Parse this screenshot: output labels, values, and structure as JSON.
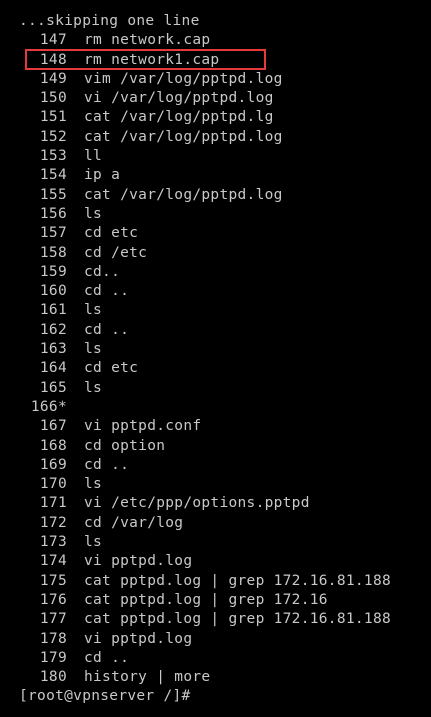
{
  "terminal": {
    "header_line": "...skipping one line",
    "history": [
      {
        "num": "147",
        "cmd": "rm network.cap"
      },
      {
        "num": "148",
        "cmd": "rm network1.cap"
      },
      {
        "num": "149",
        "cmd": "vim /var/log/pptpd.log"
      },
      {
        "num": "150",
        "cmd": "vi /var/log/pptpd.log"
      },
      {
        "num": "151",
        "cmd": "cat /var/log/pptpd.lg"
      },
      {
        "num": "152",
        "cmd": "cat /var/log/pptpd.log"
      },
      {
        "num": "153",
        "cmd": "ll"
      },
      {
        "num": "154",
        "cmd": "ip a"
      },
      {
        "num": "155",
        "cmd": "cat /var/log/pptpd.log"
      },
      {
        "num": "156",
        "cmd": "ls"
      },
      {
        "num": "157",
        "cmd": "cd etc"
      },
      {
        "num": "158",
        "cmd": "cd /etc"
      },
      {
        "num": "159",
        "cmd": "cd.."
      },
      {
        "num": "160",
        "cmd": "cd .."
      },
      {
        "num": "161",
        "cmd": "ls"
      },
      {
        "num": "162",
        "cmd": "cd .."
      },
      {
        "num": "163",
        "cmd": "ls"
      },
      {
        "num": "164",
        "cmd": "cd etc"
      },
      {
        "num": "165",
        "cmd": "ls"
      },
      {
        "num": "166*",
        "cmd": ""
      },
      {
        "num": "167",
        "cmd": "vi pptpd.conf"
      },
      {
        "num": "168",
        "cmd": "cd option"
      },
      {
        "num": "169",
        "cmd": "cd .."
      },
      {
        "num": "170",
        "cmd": "ls"
      },
      {
        "num": "171",
        "cmd": "vi /etc/ppp/options.pptpd"
      },
      {
        "num": "172",
        "cmd": "cd /var/log"
      },
      {
        "num": "173",
        "cmd": "ls"
      },
      {
        "num": "174",
        "cmd": "vi pptpd.log"
      },
      {
        "num": "175",
        "cmd": "cat pptpd.log | grep 172.16.81.188"
      },
      {
        "num": "176",
        "cmd": "cat pptpd.log | grep 172.16"
      },
      {
        "num": "177",
        "cmd": "cat pptpd.log | grep 172.16.81.188"
      },
      {
        "num": "178",
        "cmd": "vi pptpd.log"
      },
      {
        "num": "179",
        "cmd": "cd .."
      },
      {
        "num": "180",
        "cmd": "history | more"
      }
    ],
    "prompt": "[root@vpnserver /]#",
    "highlight_color": "#e53b3b",
    "text_color": "#c8c8c8",
    "background_color": "#000000"
  }
}
